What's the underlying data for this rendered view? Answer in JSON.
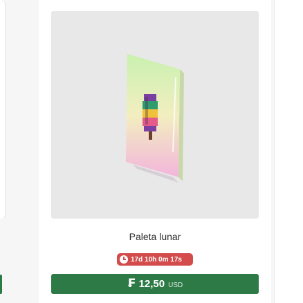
{
  "item": {
    "name": "Paleta lunar",
    "countdown": "17d 10h 0m 17s",
    "price": {
      "currency_icon": "coin-icon",
      "currency_symbol": "₣",
      "amount": "12,50",
      "unit": "USD"
    }
  },
  "colors": {
    "timer_badge": "#d34b4b",
    "buy_button": "#2d7a47",
    "media_background": "#e8e8e8",
    "card_gradient_top": "#c8f0b0",
    "card_gradient_bottom": "#f4b8dc"
  }
}
